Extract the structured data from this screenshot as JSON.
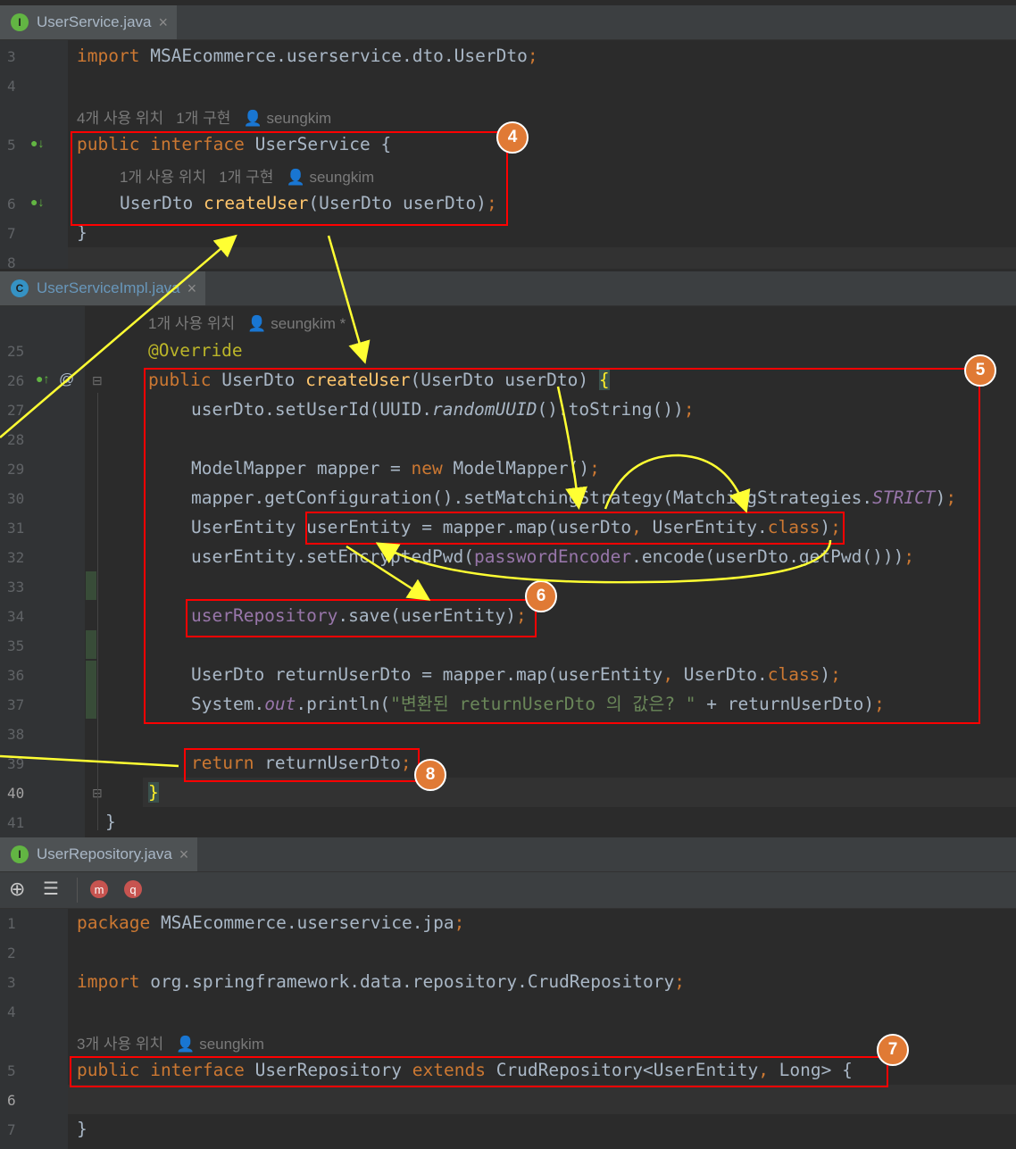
{
  "files": {
    "service": {
      "tab": "UserService.java",
      "icon": "I"
    },
    "impl": {
      "tab": "UserServiceImpl.java",
      "icon": "C"
    },
    "repo": {
      "tab": "UserRepository.java",
      "icon": "I"
    }
  },
  "service_code": {
    "lines": [
      "3",
      "4",
      "5",
      "6",
      "7",
      "8"
    ],
    "import_kw": "import",
    "import_path": "MSAEcommerce.userservice.dto.UserDto",
    "semi": ";",
    "hint1": "4개 사용 위치   1개 구현",
    "author": "seungkim",
    "public": "public",
    "interface": "interface",
    "name": "UserService {",
    "hint2": "1개 사용 위치   1개 구현",
    "method_type": "UserDto",
    "method_name": "createUser",
    "method_args": "(UserDto userDto)",
    "close": "}"
  },
  "impl_code": {
    "hint": "1개 사용 위치",
    "author": "seungkim *",
    "lines": [
      "25",
      "26",
      "27",
      "28",
      "29",
      "30",
      "31",
      "32",
      "33",
      "34",
      "35",
      "36",
      "37",
      "38",
      "39",
      "40",
      "41"
    ],
    "override": "@Override",
    "l26_public": "public",
    "l26_rest": "UserDto ",
    "l26_fn": "createUser",
    "l26_args": "(UserDto userDto) ",
    "l26_brace": "{",
    "l27a": "userDto.setUserId(UUID.",
    "l27b": "randomUUID",
    "l27c": "().toString())",
    "l29a": "ModelMapper mapper = ",
    "l29new": "new",
    "l29b": " ModelMapper()",
    "l30a": "mapper.getConfiguration().setMatchingStrategy(MatchingStrategies.",
    "l30b": "STRICT",
    "l30c": ")",
    "l31a": "UserEntity userEntity = mapper.map(userDto",
    "l31b": "UserEntity.",
    "l31c": "class",
    "l31d": ")",
    "l32a": "userEntity.setEncryptedPwd(",
    "l32b": "passwordEncoder",
    "l32c": ".encode(userDto.getPwd()))",
    "l34a": "userRepository",
    "l34b": ".save(userEntity)",
    "l36a": "UserDto returnUserDto = mapper.map(userEntity",
    "l36b": "UserDto.",
    "l36c": "class",
    "l36d": ")",
    "l37a": "System.",
    "l37b": "out",
    "l37c": ".println(",
    "l37str": "\"변환된 returnUserDto 의 값은? \"",
    "l37d": " + returnUserDto)",
    "l39kw": "return",
    "l39b": " returnUserDto",
    "brace": "}",
    "comma": ", "
  },
  "repo_code": {
    "lines": [
      "1",
      "2",
      "3",
      "4",
      "5",
      "6",
      "7"
    ],
    "package_kw": "package",
    "package_path": "MSAEcommerce.userservice.jpa",
    "import_kw": "import",
    "import_path": "org.springframework.data.repository.CrudRepository",
    "hint": "3개 사용 위치",
    "author": "seungkim",
    "public": "public",
    "interface": "interface",
    "name": "UserRepository",
    "extends": "extends",
    "generic": "CrudRepository<UserEntity",
    "generic2": "Long> {",
    "close": "}"
  },
  "badges": [
    "4",
    "5",
    "6",
    "7",
    "8"
  ],
  "colors": {
    "box": "#ff0000",
    "arrow": "#ffff33",
    "badge": "#e07a35"
  }
}
